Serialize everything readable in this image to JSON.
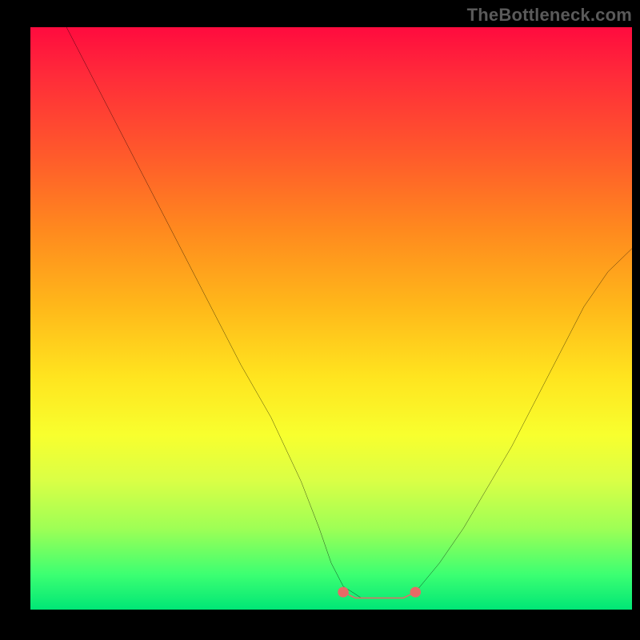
{
  "watermark": "TheBottleneck.com",
  "chart_data": {
    "type": "line",
    "title": "",
    "xlabel": "",
    "ylabel": "",
    "xlim": [
      0,
      100
    ],
    "ylim": [
      0,
      100
    ],
    "grid": false,
    "legend": false,
    "series": [
      {
        "name": "black-curve",
        "color": "#000000",
        "x": [
          6,
          10,
          15,
          20,
          25,
          30,
          35,
          40,
          45,
          48,
          50,
          52,
          55,
          58,
          60,
          62,
          64,
          68,
          72,
          76,
          80,
          84,
          88,
          92,
          96,
          100
        ],
        "values": [
          100,
          92,
          82,
          72,
          62,
          52,
          42,
          33,
          22,
          14,
          8,
          4,
          2,
          2,
          2,
          2,
          3,
          8,
          14,
          21,
          28,
          36,
          44,
          52,
          58,
          62
        ]
      },
      {
        "name": "floor-red-band",
        "color": "#e86a66",
        "x": [
          52,
          54,
          56,
          58,
          60,
          62,
          64
        ],
        "values": [
          3,
          2,
          2,
          2,
          2,
          2,
          3
        ]
      }
    ],
    "annotations": []
  },
  "colors": {
    "gradient_top": "#ff0b3e",
    "gradient_bottom": "#00e676",
    "curve": "#000000",
    "floor_band": "#e86a66",
    "frame": "#000000",
    "watermark": "#5a5a5a"
  }
}
